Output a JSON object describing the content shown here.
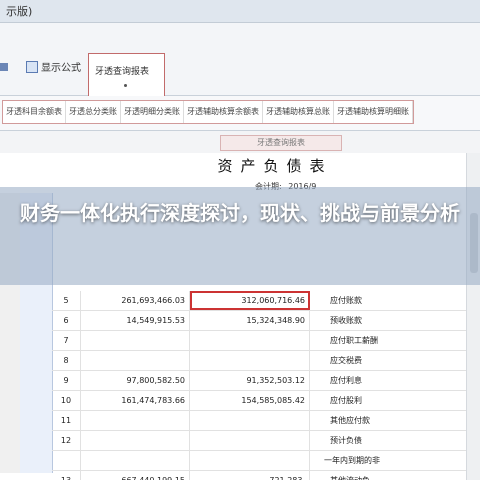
{
  "window": {
    "title": "示版)"
  },
  "ribbon": {
    "show_formula": "显示公式",
    "query_report": "牙透查询报表"
  },
  "tabs": [
    "牙透科目余额表",
    "牙透总分类账",
    "牙透明细分类账",
    "牙透辅助核算余额表",
    "牙透辅助核算总账",
    "牙透辅助核算明细账"
  ],
  "sub_button": "牙透查询报表",
  "sheet": {
    "heading": "资产负债表",
    "period_label": "会计期:",
    "period_value": "2016/9",
    "rows": [
      {
        "no": "5",
        "a": "261,693,466.03",
        "b": "312,060,716.46",
        "item": "应付账款",
        "highlight": true
      },
      {
        "no": "6",
        "a": "14,549,915.53",
        "b": "15,324,348.90",
        "item": "预收账款",
        "highlight": false
      },
      {
        "no": "7",
        "a": "",
        "b": "",
        "item": "应付职工薪酬",
        "highlight": false
      },
      {
        "no": "8",
        "a": "",
        "b": "",
        "item": "应交税费",
        "highlight": false
      },
      {
        "no": "9",
        "a": "97,800,582.50",
        "b": "91,352,503.12",
        "item": "应付利息",
        "highlight": false
      },
      {
        "no": "10",
        "a": "161,474,783.66",
        "b": "154,585,085.42",
        "item": "应付股利",
        "highlight": false
      },
      {
        "no": "11",
        "a": "",
        "b": "",
        "item": "其他应付款",
        "highlight": false
      },
      {
        "no": "12",
        "a": "",
        "b": "",
        "item": "预计负债",
        "highlight": false
      },
      {
        "no": "",
        "a": "",
        "b": "",
        "item": "一年内到期的非",
        "highlight": false
      },
      {
        "no": "13",
        "a": "667,440,199.15",
        "b": "721,283,",
        "item": "其他流动负",
        "highlight": false
      }
    ]
  },
  "overlay": {
    "title": "财务一体化执行深度探讨，现状、挑战与前景分析"
  }
}
